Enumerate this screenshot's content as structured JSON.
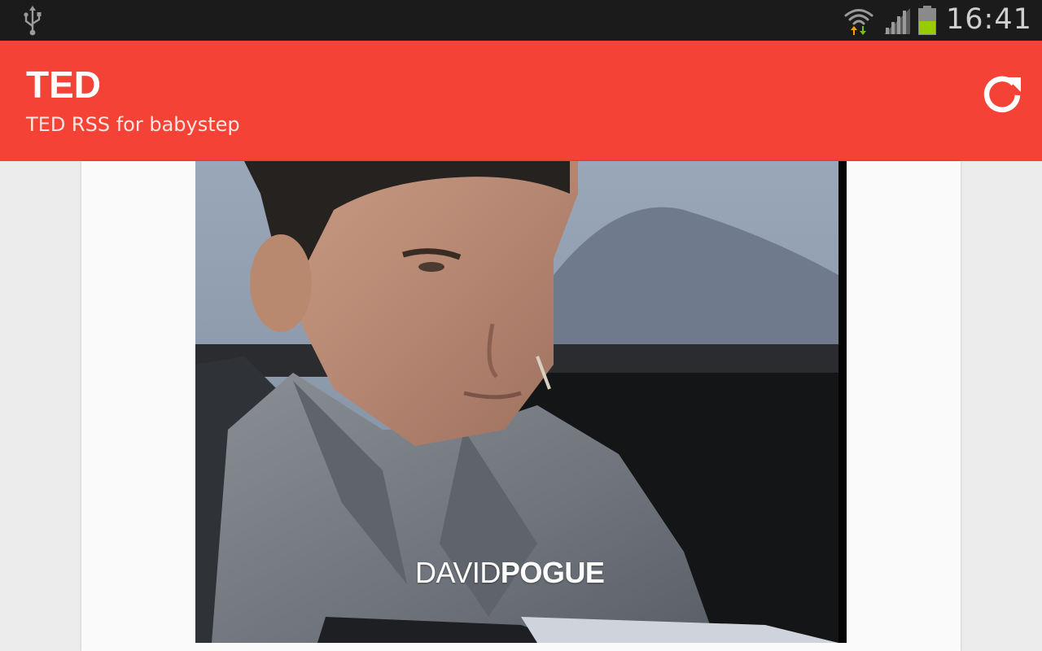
{
  "status_bar": {
    "time": "16:41",
    "icons": [
      "usb-icon",
      "wifi-icon",
      "signal-icon",
      "battery-icon"
    ],
    "battery_color": "#99cc00"
  },
  "action_bar": {
    "title": "TED",
    "subtitle": "TED RSS for babystep",
    "refresh_icon": "refresh-icon",
    "color": "#f44336"
  },
  "feed": {
    "items": [
      {
        "thumbnail_caption_first": "DAVID",
        "thumbnail_caption_last": "POGUE"
      }
    ]
  }
}
